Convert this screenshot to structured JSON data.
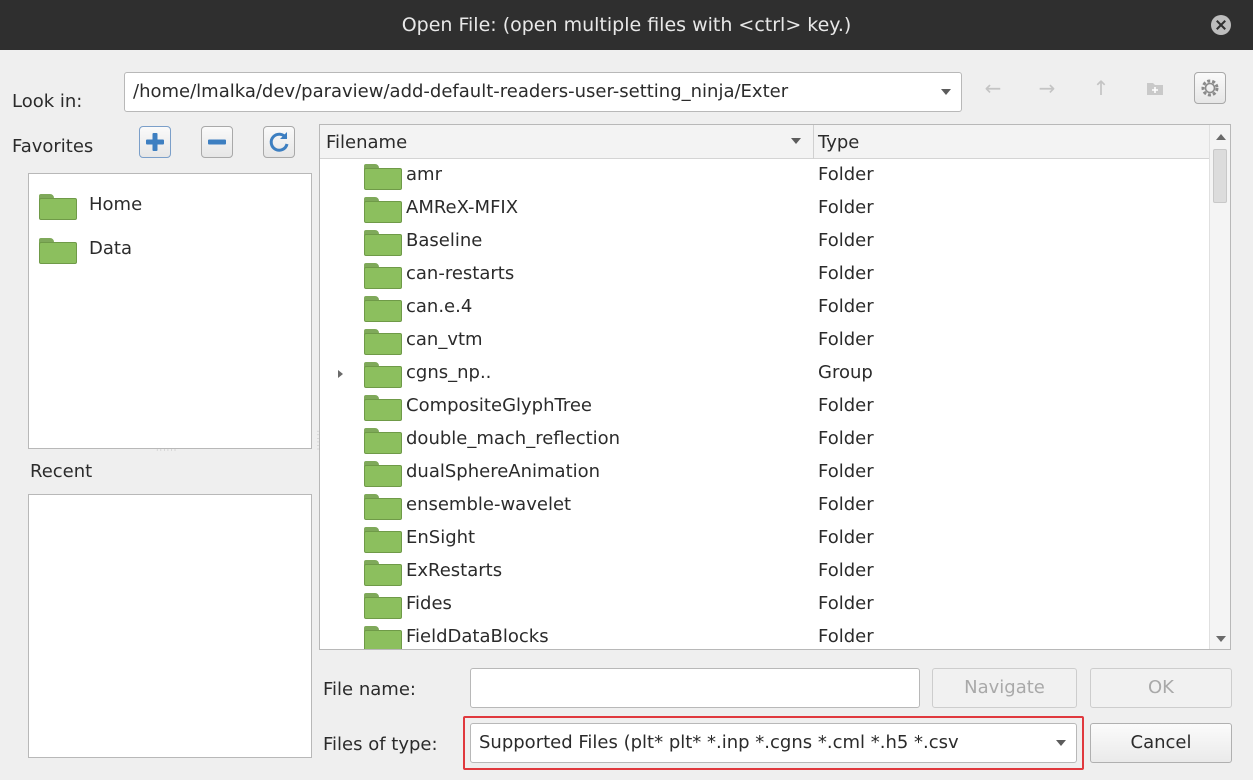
{
  "window": {
    "title": "Open File:  (open multiple files with <ctrl> key.)"
  },
  "look_in": {
    "label": "Look in:",
    "path": "/home/lmalka/dev/paraview/add-default-readers-user-setting_ninja/Exter"
  },
  "nav_icons": [
    "back-arrow-icon",
    "forward-arrow-icon",
    "up-arrow-icon",
    "new-folder-icon",
    "settings-gear-icon"
  ],
  "favorites": {
    "label": "Favorites",
    "items": [
      {
        "label": "Home",
        "icon": "folder-icon"
      },
      {
        "label": "Data",
        "icon": "folder-icon"
      }
    ]
  },
  "recent": {
    "label": "Recent",
    "items": []
  },
  "file_list": {
    "columns": [
      "Filename",
      "Type"
    ],
    "rows": [
      {
        "name": "amr",
        "type": "Folder"
      },
      {
        "name": "AMReX-MFIX",
        "type": "Folder"
      },
      {
        "name": "Baseline",
        "type": "Folder"
      },
      {
        "name": "can-restarts",
        "type": "Folder"
      },
      {
        "name": "can.e.4",
        "type": "Folder"
      },
      {
        "name": "can_vtm",
        "type": "Folder"
      },
      {
        "name": "cgns_np..",
        "type": "Group",
        "expandable": true
      },
      {
        "name": "CompositeGlyphTree",
        "type": "Folder"
      },
      {
        "name": "double_mach_reflection",
        "type": "Folder"
      },
      {
        "name": "dualSphereAnimation",
        "type": "Folder"
      },
      {
        "name": "ensemble-wavelet",
        "type": "Folder"
      },
      {
        "name": "EnSight",
        "type": "Folder"
      },
      {
        "name": "ExRestarts",
        "type": "Folder"
      },
      {
        "name": "Fides",
        "type": "Folder"
      },
      {
        "name": "FieldDataBlocks",
        "type": "Folder"
      }
    ]
  },
  "file_name": {
    "label": "File name:",
    "value": ""
  },
  "files_of_type": {
    "label": "Files of type:",
    "selected": "Supported Files (plt* plt* *.inp *.cgns *.cml *.h5 *.csv"
  },
  "buttons": {
    "navigate": "Navigate",
    "ok": "OK",
    "cancel": "Cancel"
  },
  "colors": {
    "titlebar": "#2f2f2f",
    "dialog_bg": "#efefef",
    "folder_green": "#8cbf5e",
    "highlight_red": "#e0393e"
  }
}
